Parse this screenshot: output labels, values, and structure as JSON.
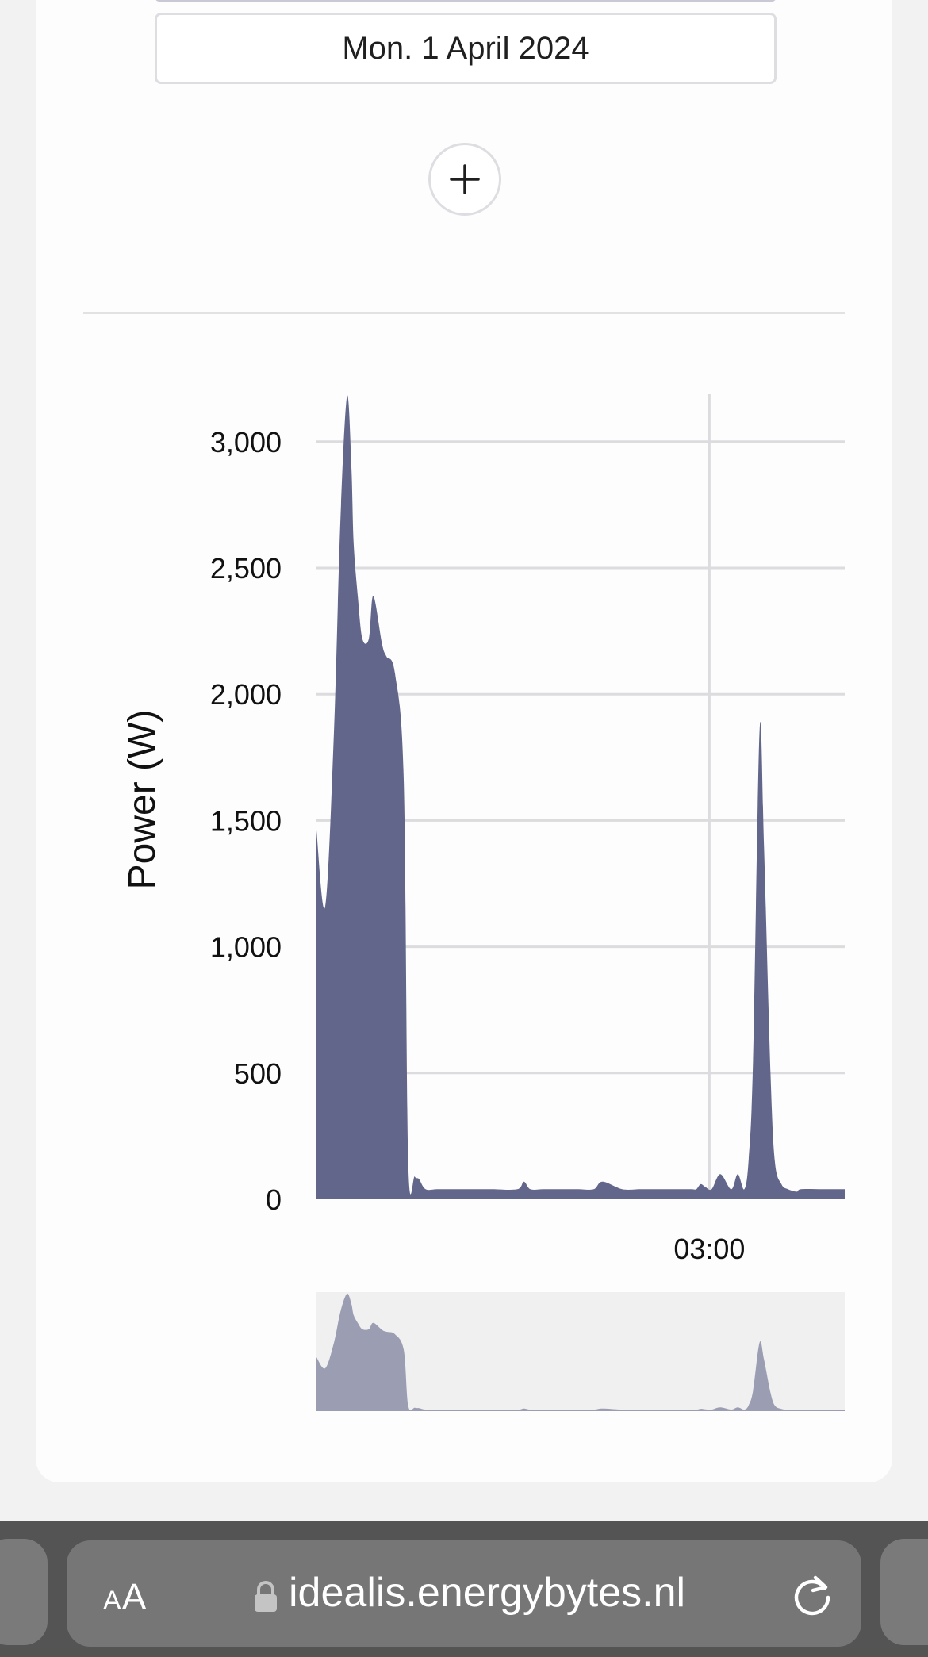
{
  "form": {
    "date_value": "Mon. 1 April 2024"
  },
  "icons": {
    "add": "plus-icon",
    "lock": "lock-icon",
    "reload": "reload-icon"
  },
  "colors": {
    "series_fill": "#62668a",
    "navigator_fill": "#9b9db2",
    "navigator_bg": "#f0f0f0",
    "grid": "#dcdcdf"
  },
  "chart_data": {
    "type": "area",
    "ylabel": "Power (W)",
    "xlabel": "",
    "ylim": [
      0,
      3200
    ],
    "yticks": [
      {
        "value": 0,
        "label": "0"
      },
      {
        "value": 500,
        "label": "500"
      },
      {
        "value": 1000,
        "label": "1,000"
      },
      {
        "value": 1500,
        "label": "1,500"
      },
      {
        "value": 2000,
        "label": "2,000"
      },
      {
        "value": 2500,
        "label": "2,500"
      },
      {
        "value": 3000,
        "label": "3,000"
      }
    ],
    "xlim_minutes": [
      0,
      242
    ],
    "xticks": [
      {
        "minutes": 180,
        "label": "03:00"
      }
    ],
    "x_minutes": [
      0,
      4,
      8,
      11,
      14,
      16,
      17,
      19,
      21,
      24,
      26,
      30,
      32,
      36,
      40,
      42,
      45,
      47,
      50,
      56,
      70,
      80,
      92,
      95,
      98,
      104,
      114,
      120,
      127,
      131,
      140,
      148,
      152,
      162,
      168,
      172,
      174,
      176,
      178,
      181,
      185,
      190,
      193,
      196,
      198,
      200,
      203,
      205,
      208,
      210,
      213,
      216,
      220,
      222,
      232,
      242
    ],
    "y_watts": [
      1460,
      1160,
      1850,
      2700,
      3180,
      2900,
      2600,
      2380,
      2220,
      2220,
      2390,
      2200,
      2150,
      2080,
      1650,
      150,
      90,
      80,
      40,
      40,
      40,
      40,
      40,
      70,
      40,
      40,
      40,
      40,
      40,
      70,
      40,
      40,
      40,
      40,
      40,
      40,
      40,
      60,
      50,
      40,
      100,
      40,
      100,
      40,
      160,
      550,
      1860,
      1400,
      500,
      150,
      60,
      40,
      30,
      40,
      40,
      40
    ]
  },
  "browser": {
    "aa_small": "A",
    "aa_large": "A",
    "url": "idealis.energybytes.nl"
  }
}
